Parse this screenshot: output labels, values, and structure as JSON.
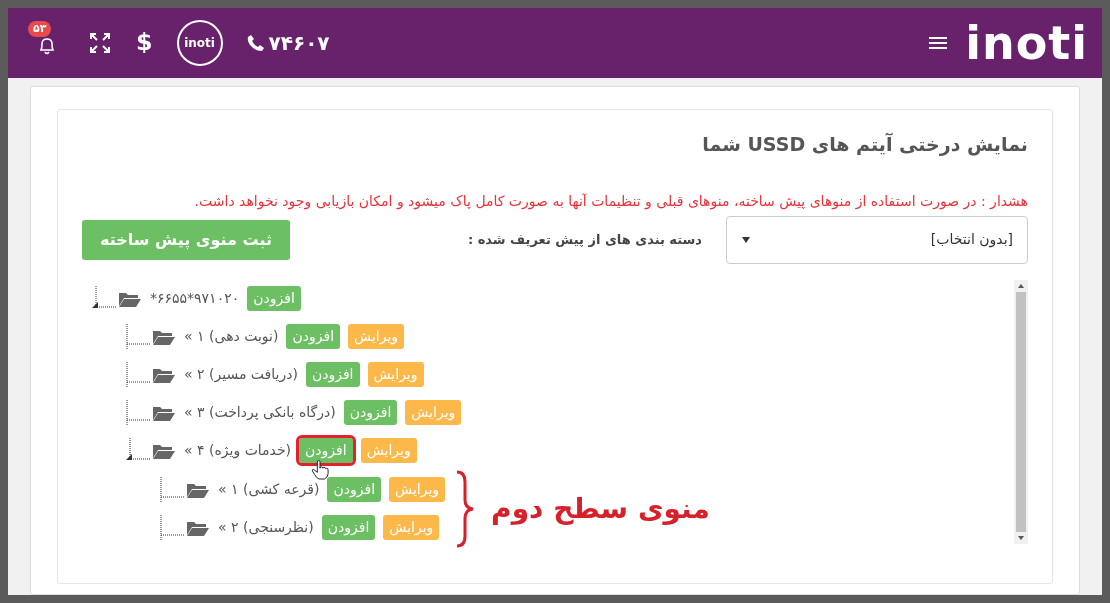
{
  "header": {
    "logo": "inoti",
    "notifications": "۵۳",
    "currency": "$",
    "badge_logo": "inoti",
    "phone": "۷۴۶۰۷"
  },
  "panel": {
    "title": "نمایش درختی آیتم های USSD شما",
    "warning": "هشدار : در صورت استفاده از منوهای پیش ساخته، منوهای قبلی و تنظیمات آنها به صورت کامل پاک میشود و امکان بازیابی وجود نخواهد داشت.",
    "category_label": "دسته بندی های از پیش تعریف شده :",
    "category_select": {
      "value": "[بدون انتخاب]"
    },
    "submit_button": "ثبت منوی پیش ساخته"
  },
  "tree": {
    "nodes": [
      {
        "label": "*۶۶۵۵*۹۷۱۰۲۰",
        "expanded": true,
        "buttons": [
          {
            "kind": "add",
            "label": "افزودن",
            "highlighted": false
          }
        ],
        "children": [
          {
            "label": "(نوبت دهی) ۱ »",
            "expanded": false,
            "buttons": [
              {
                "kind": "edit",
                "label": "ویرایش",
                "highlighted": false
              },
              {
                "kind": "add",
                "label": "افزودن",
                "highlighted": false
              }
            ]
          },
          {
            "label": "(دریافت مسیر) ۲ »",
            "expanded": false,
            "buttons": [
              {
                "kind": "edit",
                "label": "ویرایش",
                "highlighted": false
              },
              {
                "kind": "add",
                "label": "افزودن",
                "highlighted": false
              }
            ]
          },
          {
            "label": "(درگاه بانکی پرداخت) ۳ »",
            "expanded": false,
            "buttons": [
              {
                "kind": "edit",
                "label": "ویرایش",
                "highlighted": false
              },
              {
                "kind": "add",
                "label": "افزودن",
                "highlighted": false
              }
            ]
          },
          {
            "label": "(خدمات ویژه) ۴ »",
            "expanded": true,
            "buttons": [
              {
                "kind": "edit",
                "label": "ویرایش",
                "highlighted": false
              },
              {
                "kind": "add",
                "label": "افزودن",
                "highlighted": true
              }
            ],
            "annotation": {
              "text": "منوی سطح دوم"
            },
            "children": [
              {
                "label": "(قرعه کشی) ۱ »",
                "expanded": false,
                "buttons": [
                  {
                    "kind": "edit",
                    "label": "ویرایش",
                    "highlighted": false
                  },
                  {
                    "kind": "add",
                    "label": "افزودن",
                    "highlighted": false
                  }
                ]
              },
              {
                "label": "(نظرسنجی) ۲ »",
                "expanded": false,
                "buttons": [
                  {
                    "kind": "edit",
                    "label": "ویرایش",
                    "highlighted": false
                  },
                  {
                    "kind": "add",
                    "label": "افزودن",
                    "highlighted": false
                  }
                ]
              }
            ]
          }
        ]
      }
    ]
  }
}
